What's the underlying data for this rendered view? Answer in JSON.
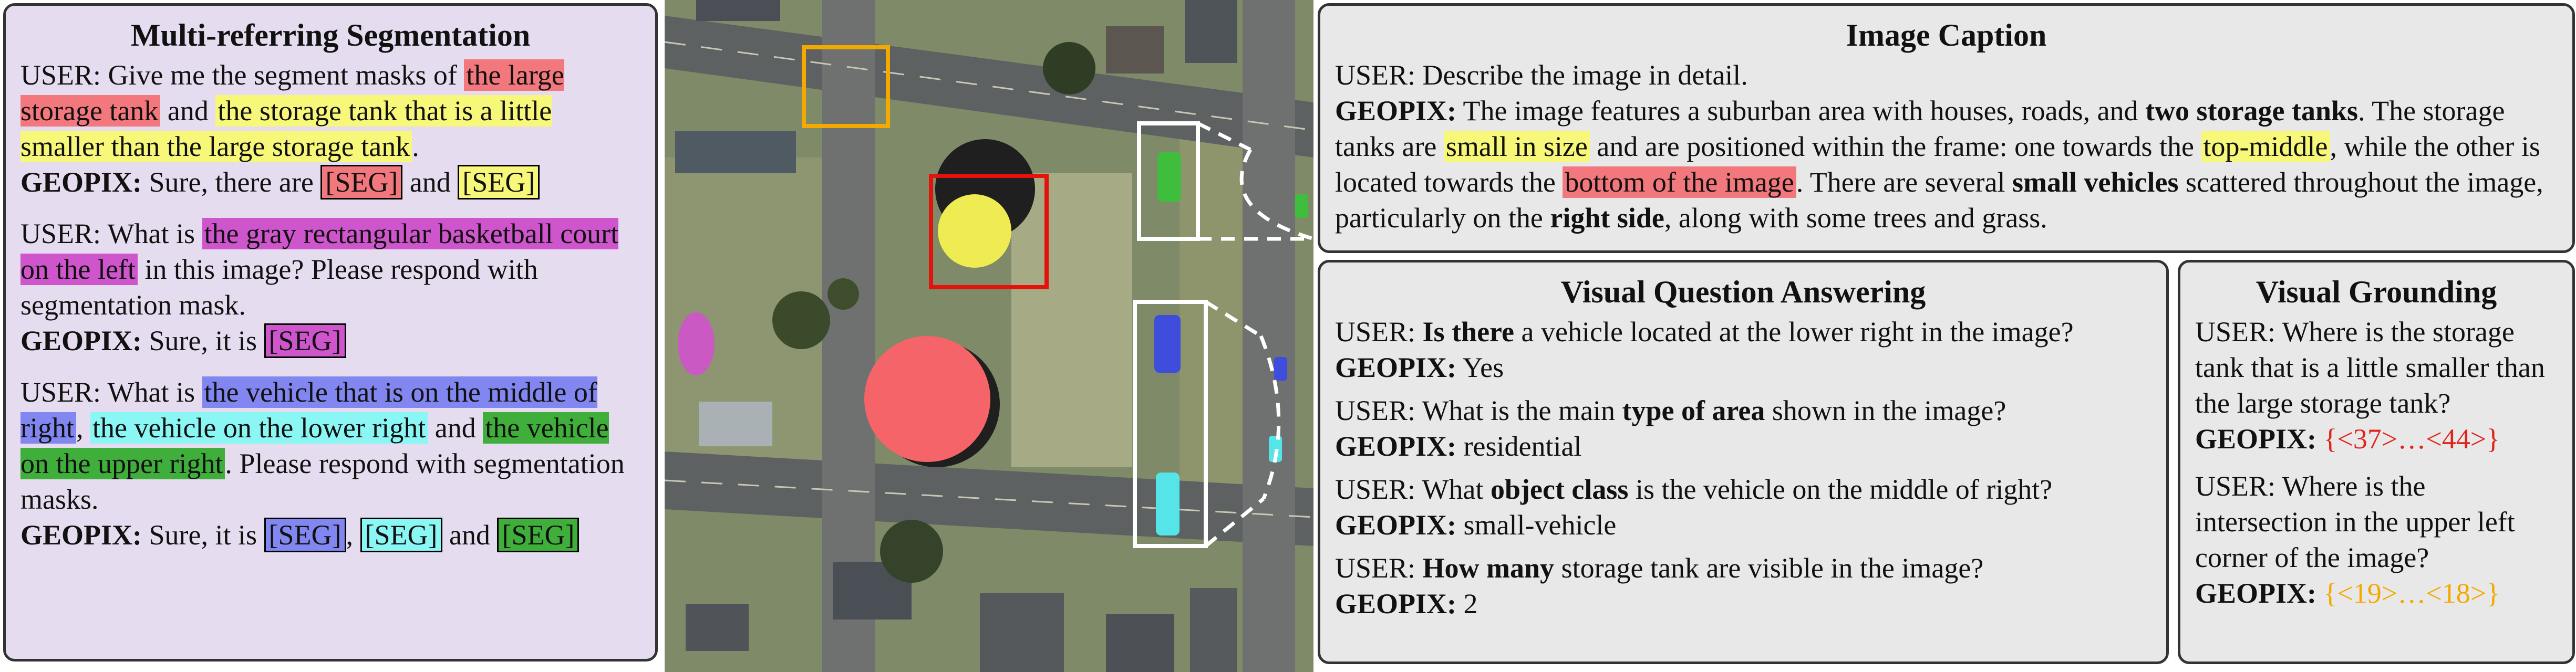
{
  "multi": {
    "title": "Multi-referring Segmentation",
    "q1_user": "USER: Give me the segment masks of",
    "q1_r1": "the large storage tank",
    "q1_and": "and",
    "q1_r2": "the storage tank that is a little smaller than the large storage tank",
    "q1_end": ".",
    "q1_gp_label": "GEOPIX:",
    "q1_gp_text": "Sure, there are",
    "seg": "[SEG]",
    "and": "and",
    "q2_user": "USER: What is",
    "q2_r1": "the gray rectangular basketball court on the left",
    "q2_rest": "in this image? Please respond with segmentation mask.",
    "q2_gp_label": "GEOPIX:",
    "q2_gp_text": "Sure, it is",
    "q3_user": "USER: What is",
    "q3_r1": "the vehicle that is on the middle of right",
    "q3_comma": ",",
    "q3_r2": "the vehicle on the lower right",
    "q3_and": "and",
    "q3_r3": "the vehicle on the upper right",
    "q3_rest": ". Please respond with segmentation masks.",
    "q3_gp_label": "GEOPIX:",
    "q3_gp_text": "Sure, it is",
    "comma": ","
  },
  "caption": {
    "title": "Image Caption",
    "user": "USER: Describe the image in detail.",
    "gp_label": "GEOPIX:",
    "t1": "The image features a suburban area with houses, roads, and",
    "b1": "two storage tanks",
    "t2": ". The storage tanks are",
    "h1": "small in size",
    "t3": "and are positioned within the frame: one towards the",
    "h2": "top-middle",
    "t4": ", while the other is located towards the",
    "h3": "bottom of the image",
    "t5": ". There are several",
    "b2": "small vehicles",
    "t6": "scattered throughout the image, particularly on the",
    "b3": "right side",
    "t7": ", along with some trees and grass."
  },
  "vqa": {
    "title": "Visual Question Answering",
    "q1_a": "USER:",
    "q1_b": "Is there",
    "q1_c": "a vehicle located at the lower right in the image?",
    "a1_label": "GEOPIX:",
    "a1": "Yes",
    "q2_a": "USER: What is the main",
    "q2_b": "type of area",
    "q2_c": "shown in the image?",
    "a2_label": "GEOPIX:",
    "a2": "residential",
    "q3_a": "USER: What",
    "q3_b": "object class",
    "q3_c": "is the vehicle on the middle of right?",
    "a3_label": "GEOPIX:",
    "a3": "small-vehicle",
    "q4_a": "USER:",
    "q4_b": "How many",
    "q4_c": "storage tank are visible in the image?",
    "a4_label": "GEOPIX:",
    "a4": "2"
  },
  "vg": {
    "title": "Visual Grounding",
    "q1": "USER: Where is the storage tank that is a little smaller than the large storage tank?",
    "a1_label": "GEOPIX:",
    "a1": "{<37>…<44>}",
    "q2": "USER: Where is the intersection in the upper left corner of the image?",
    "a2_label": "GEOPIX:",
    "a2": "{<19>…<18>}"
  },
  "colors": {
    "red_highlight": "#f3787d",
    "yellow_highlight": "#f7f77a",
    "magenta_highlight": "#cf55cc",
    "blue_highlight": "#8286f0",
    "cyan_highlight": "#8af7f5",
    "green_highlight": "#3fae3a",
    "red_box": "#e3120b",
    "orange_box": "#f4a900"
  }
}
